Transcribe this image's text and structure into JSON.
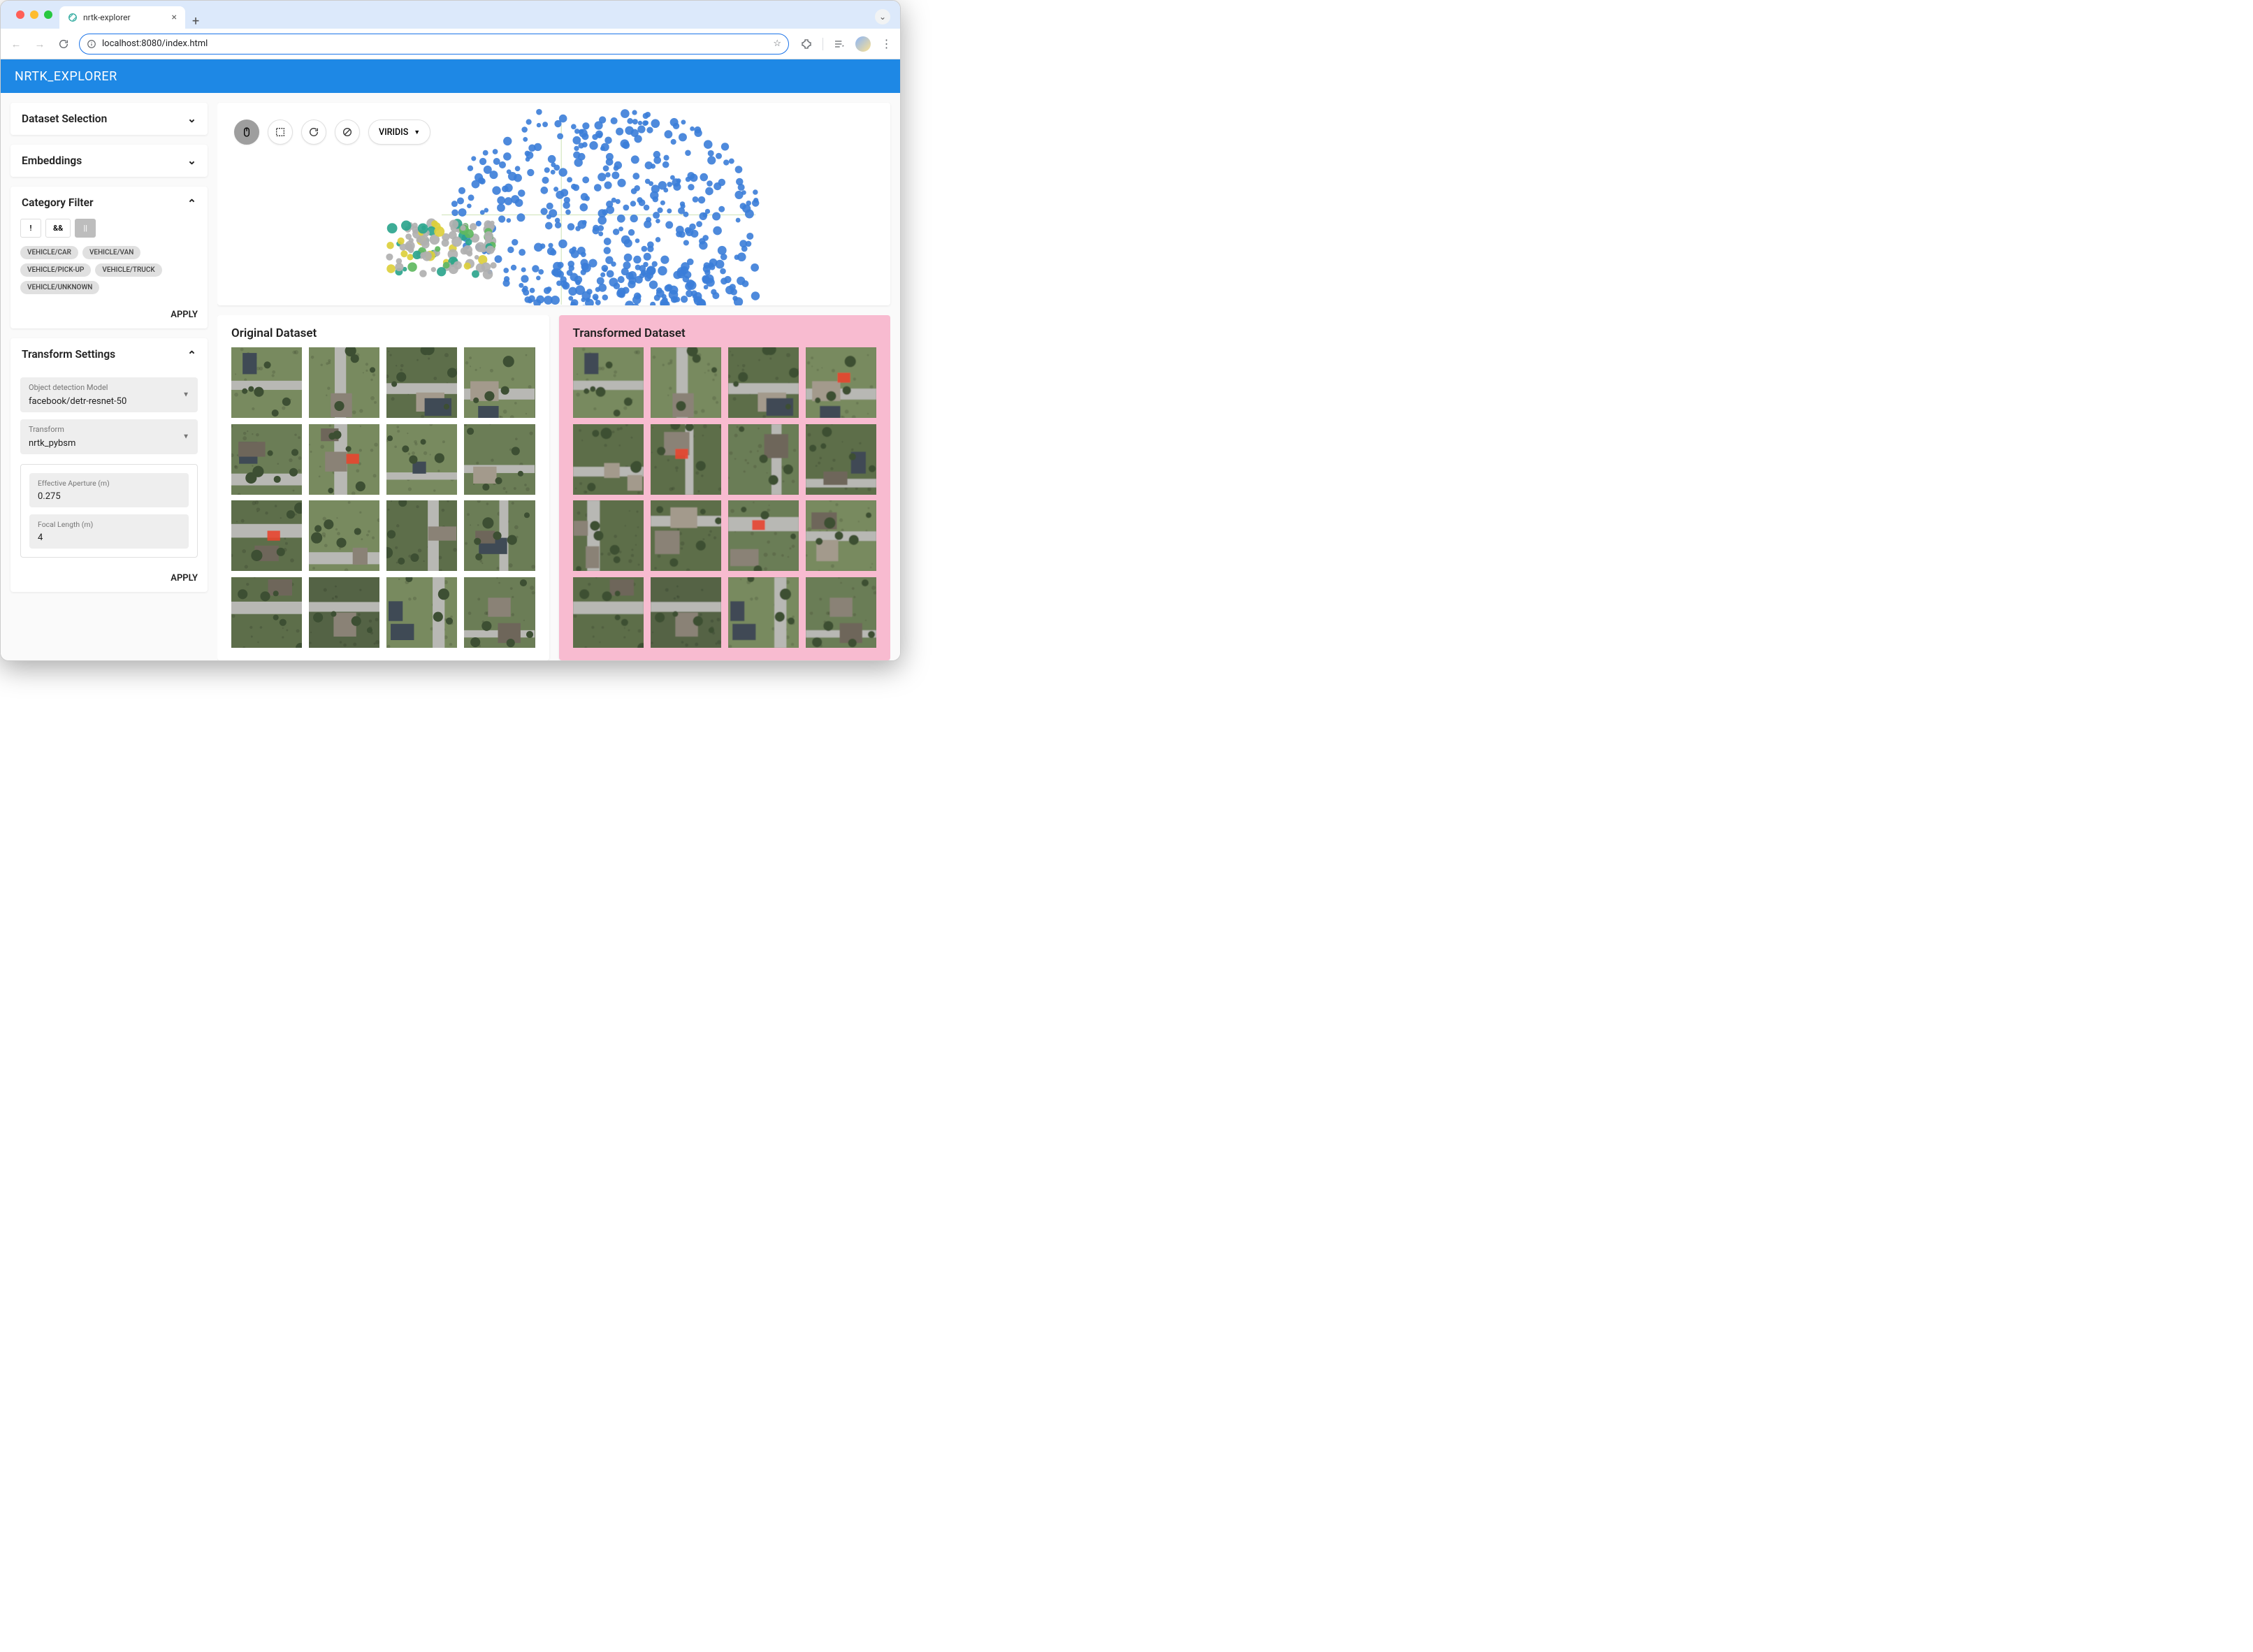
{
  "browser": {
    "tab_title": "nrtk-explorer",
    "url": "localhost:8080/index.html"
  },
  "app": {
    "title": "NRTK_EXPLORER"
  },
  "sidebar": {
    "dataset_selection": {
      "title": "Dataset Selection",
      "expanded": false
    },
    "embeddings": {
      "title": "Embeddings",
      "expanded": false
    },
    "category_filter": {
      "title": "Category Filter",
      "expanded": true,
      "operators": [
        "!",
        "&&",
        "||"
      ],
      "chips": [
        "VEHICLE/CAR",
        "VEHICLE/VAN",
        "VEHICLE/PICK-UP",
        "VEHICLE/TRUCK",
        "VEHICLE/UNKNOWN"
      ],
      "apply_label": "APPLY"
    },
    "transform_settings": {
      "title": "Transform Settings",
      "expanded": true,
      "model_label": "Object detection Model",
      "model_value": "facebook/detr-resnet-50",
      "transform_label": "Transform",
      "transform_value": "nrtk_pybsm",
      "params": [
        {
          "label": "Effective Aperture (m)",
          "value": "0.275"
        },
        {
          "label": "Focal Length (m)",
          "value": "4"
        }
      ],
      "apply_label": "APPLY"
    }
  },
  "scatter": {
    "colormap": "VIRIDIS"
  },
  "datasets": {
    "original_title": "Original Dataset",
    "transformed_title": "Transformed Dataset"
  },
  "colors": {
    "primary": "#1E88E5",
    "pink_bg": "#F8BBD0",
    "scatter_blue": "#3b7dd8",
    "scatter_teal": "#2ca58d",
    "scatter_green": "#5fb85f",
    "scatter_yellow": "#dccf3c",
    "scatter_gray": "#b0b0b0"
  }
}
